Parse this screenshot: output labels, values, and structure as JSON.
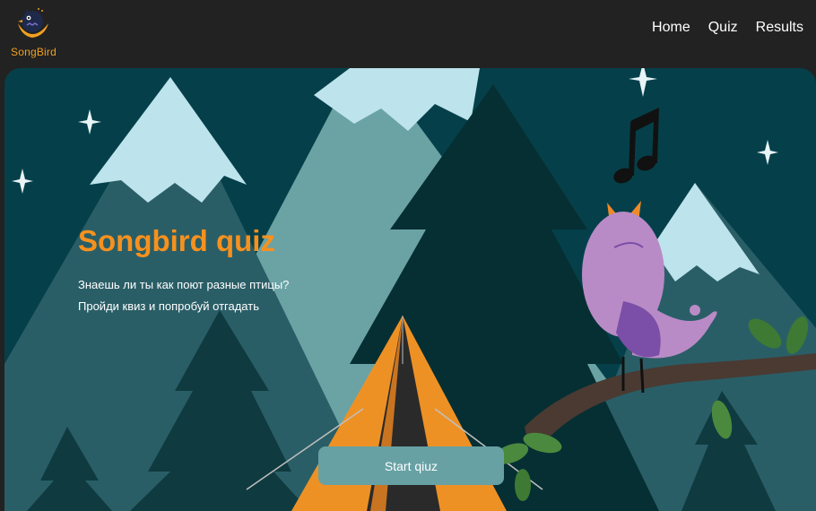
{
  "header": {
    "logo_text": "SongBird",
    "nav": [
      {
        "label": "Home"
      },
      {
        "label": "Quiz"
      },
      {
        "label": "Results"
      }
    ]
  },
  "hero": {
    "title": "Songbird quiz",
    "line1": "Знаешь ли ты как поют разные птицы?",
    "line2": "Пройди квиз и попробуй отгадать",
    "start_button": "Start qiuz"
  },
  "colors": {
    "background": "#222222",
    "accent": "#f6911e",
    "button": "#67a1a4",
    "sky": "#05404a"
  },
  "icons": {
    "logo": "songbird-logo-icon"
  }
}
